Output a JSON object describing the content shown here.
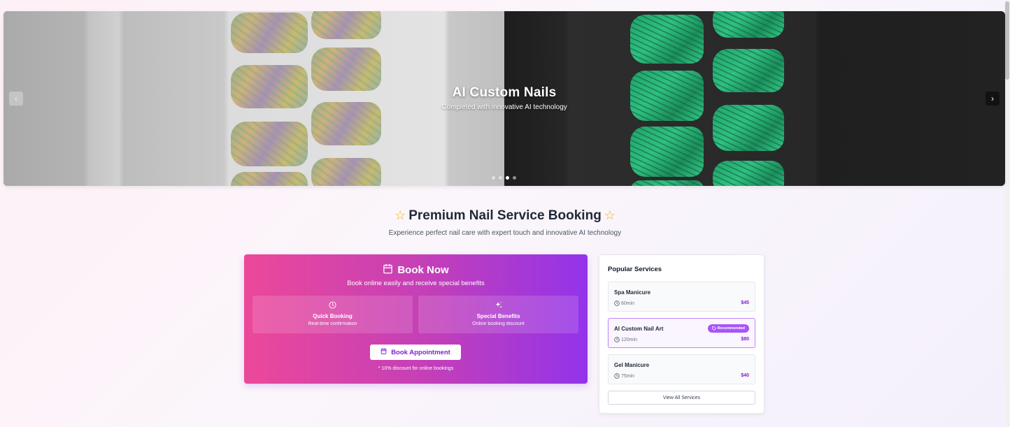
{
  "hero": {
    "title": "AI Custom Nails",
    "subtitle": "Completed with innovative AI technology",
    "prev_label": "‹",
    "next_label": "›",
    "slide_count": 4,
    "active_slide": 3
  },
  "section": {
    "title": "Premium Nail Service Booking",
    "star_icon": "☆",
    "subtitle": "Experience perfect nail care with expert touch and innovative AI technology"
  },
  "booking": {
    "title": "Book Now",
    "subtitle": "Book online easily and receive special benefits",
    "features": [
      {
        "icon": "clock-icon",
        "title": "Quick Booking",
        "desc": "Real-time confirmation"
      },
      {
        "icon": "sparkles-icon",
        "title": "Special Benefits",
        "desc": "Online booking discount"
      }
    ],
    "button_label": "Book Appointment",
    "note": "* 10% discount for online bookings",
    "gradient_start": "#ec4899",
    "gradient_end": "#9333ea"
  },
  "popular": {
    "title": "Popular Services",
    "services": [
      {
        "name": "Spa Manicure",
        "duration": "60min",
        "price": "$45",
        "badge": ""
      },
      {
        "name": "AI Custom Nail Art",
        "duration": "120min",
        "price": "$80",
        "badge": "Recommended"
      },
      {
        "name": "Gel Manicure",
        "duration": "75min",
        "price": "$40",
        "badge": ""
      }
    ],
    "view_all_label": "View All Services",
    "accent_color": "#7e22ce"
  }
}
